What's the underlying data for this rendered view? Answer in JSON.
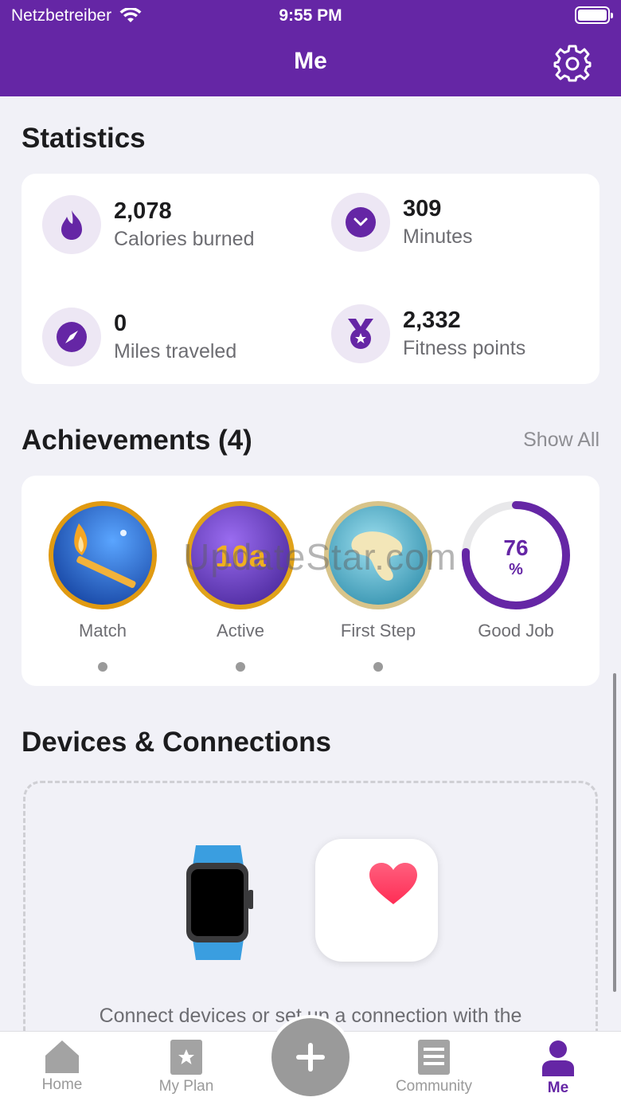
{
  "status_bar": {
    "carrier": "Netzbetreiber",
    "time": "9:55 PM"
  },
  "header": {
    "title": "Me"
  },
  "statistics": {
    "title": "Statistics",
    "items": [
      {
        "value": "2,078",
        "label": "Calories burned",
        "icon": "flame-icon"
      },
      {
        "value": "309",
        "label": "Minutes",
        "icon": "clock-icon"
      },
      {
        "value": "0",
        "label": "Miles traveled",
        "icon": "compass-icon"
      },
      {
        "value": "2,332",
        "label": "Fitness points",
        "icon": "medal-icon"
      }
    ]
  },
  "achievements": {
    "title": "Achievements (4)",
    "show_all": "Show All",
    "items": [
      {
        "label": "Match"
      },
      {
        "label": "Active",
        "badge_text": "10a"
      },
      {
        "label": "First Step"
      },
      {
        "label": "Good Job",
        "progress_value": "76",
        "progress_unit": "%",
        "progress_fraction": 0.76
      }
    ],
    "watermark": "UpdateStar.com"
  },
  "devices": {
    "title": "Devices & Connections",
    "description": "Connect devices or set up a connection with the"
  },
  "tabbar": {
    "items": [
      {
        "label": "Home"
      },
      {
        "label": "My Plan"
      },
      {
        "label": "Community"
      },
      {
        "label": "Me"
      }
    ]
  },
  "colors": {
    "accent": "#6526a5",
    "icon_bg": "#ede7f4",
    "muted": "#9a9a9a",
    "background": "#f1f1f7"
  }
}
